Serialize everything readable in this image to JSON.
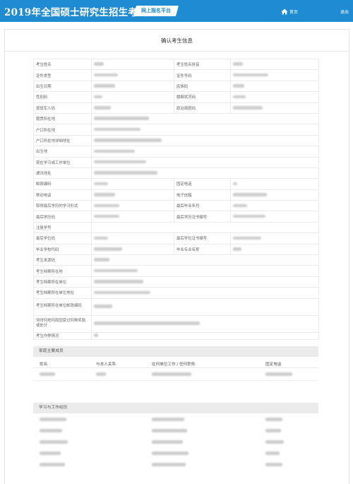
{
  "header": {
    "title": "2019年全国硕士研究生招生考试",
    "badge": "网上报名平台",
    "home": "首页",
    "logout": "退出",
    "home_icon": "house-icon",
    "bg_color": "#1e8bd2"
  },
  "panel": {
    "title": "确认考生信息"
  },
  "info_rows": [
    {
      "type": "pair",
      "l1": "考生姓名",
      "l2": "考生姓名拼音"
    },
    {
      "type": "pair",
      "l1": "证件类型",
      "l2": "证件号码"
    },
    {
      "type": "pair",
      "l1": "出生日期",
      "l2": "民族码"
    },
    {
      "type": "pair",
      "l1": "性别码",
      "l2": "婚姻状况码"
    },
    {
      "type": "pair",
      "l1": "现役军人码",
      "l2": "政治面貌码"
    },
    {
      "type": "full",
      "l1": "籍贯所在地"
    },
    {
      "type": "full",
      "l1": "户口所在地"
    },
    {
      "type": "full",
      "l1": "户口所在地详细地址"
    },
    {
      "type": "full",
      "l1": "出生地"
    },
    {
      "type": "full",
      "l1": "现在学习或工作单位"
    },
    {
      "type": "full",
      "l1": "通讯地址"
    },
    {
      "type": "pair",
      "l1": "邮政编码",
      "l2": "固定电话"
    },
    {
      "type": "pair",
      "l1": "移动电话",
      "l2": "电子信箱"
    },
    {
      "type": "pair",
      "l1": "取得最后学历的学习形式",
      "l2": "最后毕业年月"
    },
    {
      "type": "pair",
      "l1": "最后学历码",
      "l2": "最后学历证书编号"
    },
    {
      "type": "full",
      "l1": "注册学号"
    },
    {
      "type": "pair",
      "l1": "最后学位码",
      "l2": "最后学位证书编号"
    },
    {
      "type": "pair",
      "l1": "毕业学校代码",
      "l2": "毕业专业名称"
    },
    {
      "type": "full",
      "l1": "考生来源码"
    },
    {
      "type": "full",
      "l1": "考生档案所在地"
    },
    {
      "type": "full",
      "l1": "考生档案所在单位"
    },
    {
      "type": "full",
      "l1": "考生档案所在单位地址"
    },
    {
      "type": "full",
      "l1": "考生档案所在单位邮政编码"
    },
    {
      "type": "full",
      "l1": "何时何地何原因受过何种奖励或处分"
    },
    {
      "type": "full",
      "l1": "考生作弊情况"
    }
  ],
  "family": {
    "title": "家庭主要成员",
    "columns": [
      "姓名",
      "与本人关系",
      "在何单位工作 / 任何职务",
      "固定电话"
    ]
  },
  "history": {
    "title": "学习与工作经历"
  }
}
